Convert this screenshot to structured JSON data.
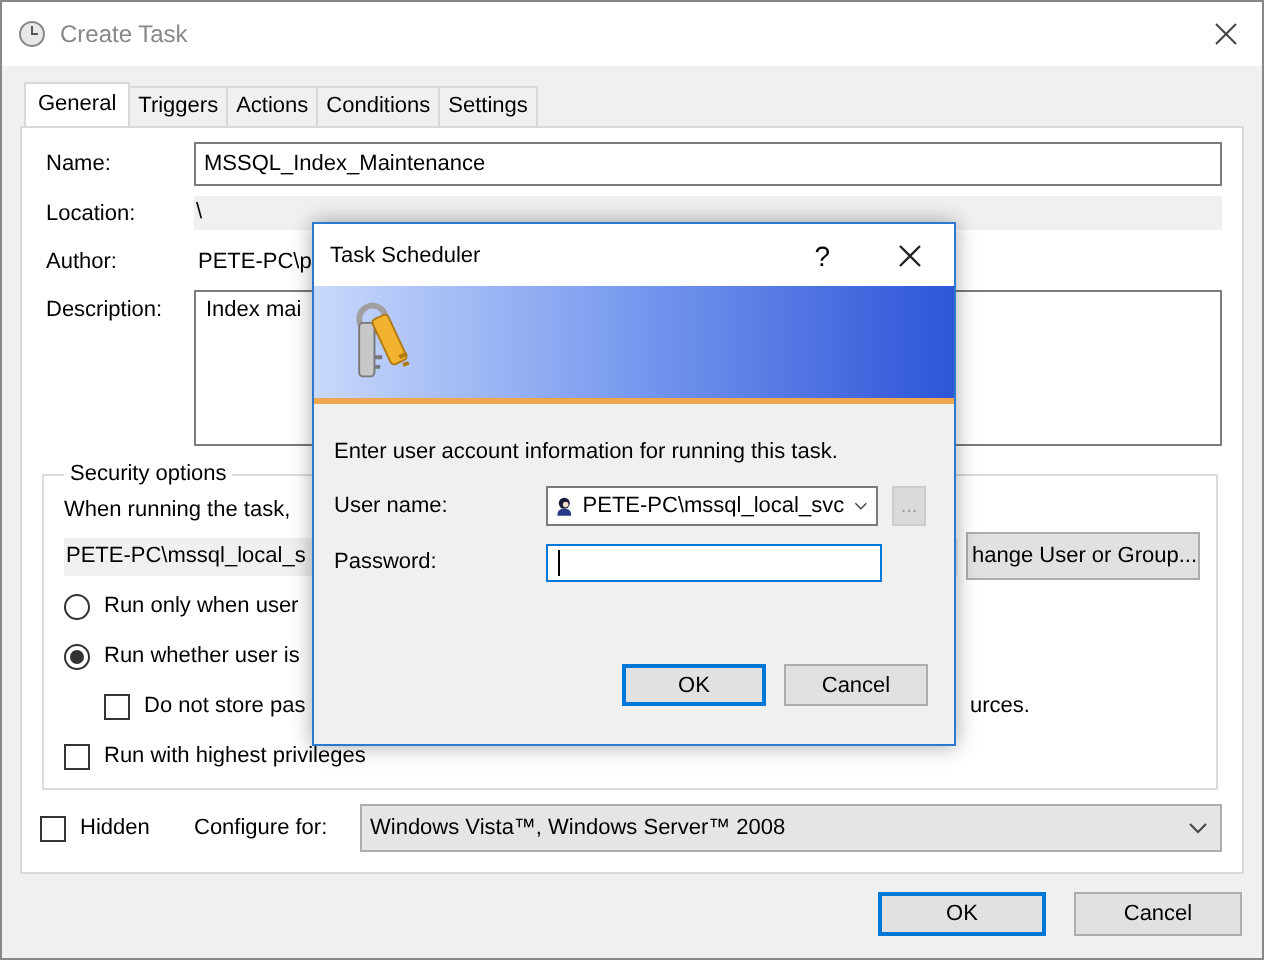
{
  "window": {
    "title": "Create Task"
  },
  "tabs": [
    {
      "label": "General",
      "selected": true
    },
    {
      "label": "Triggers",
      "selected": false
    },
    {
      "label": "Actions",
      "selected": false
    },
    {
      "label": "Conditions",
      "selected": false
    },
    {
      "label": "Settings",
      "selected": false
    }
  ],
  "general": {
    "name": {
      "label": "Name:",
      "value": "MSSQL_Index_Maintenance"
    },
    "location": {
      "label": "Location:",
      "value": "\\"
    },
    "author": {
      "label": "Author:",
      "value": "PETE-PC\\p"
    },
    "description": {
      "label": "Description:",
      "value": "Index mai"
    }
  },
  "security": {
    "title": "Security options",
    "prompt": "When running the task,",
    "account": "PETE-PC\\mssql_local_s",
    "change_button": "hange User or Group...",
    "options": [
      {
        "kind": "radio",
        "label": "Run only when user",
        "selected": false
      },
      {
        "kind": "radio",
        "label": "Run whether user is",
        "selected": true,
        "children": [
          {
            "kind": "checkbox",
            "label": "Do not store pas",
            "tail": "urces.",
            "checked": false
          }
        ]
      },
      {
        "kind": "checkbox",
        "label": "Run with highest privileges",
        "checked": false
      }
    ]
  },
  "hidden": {
    "label": "Hidden",
    "checked": false
  },
  "configure": {
    "label": "Configure for:",
    "value": "Windows Vista™, Windows Server™ 2008"
  },
  "buttons": [
    {
      "label": "OK",
      "default": true
    },
    {
      "label": "Cancel",
      "default": false
    }
  ],
  "modal": {
    "title": "Task Scheduler",
    "help": "?",
    "instruction": "Enter user account information for running this task.",
    "user": {
      "label": "User name:",
      "value": "PETE-PC\\mssql_local_svc"
    },
    "browse": {
      "label": "...",
      "disabled": true
    },
    "password": {
      "label": "Password:"
    },
    "buttons": [
      {
        "label": "OK",
        "default": true
      },
      {
        "label": "Cancel",
        "default": false
      }
    ]
  }
}
